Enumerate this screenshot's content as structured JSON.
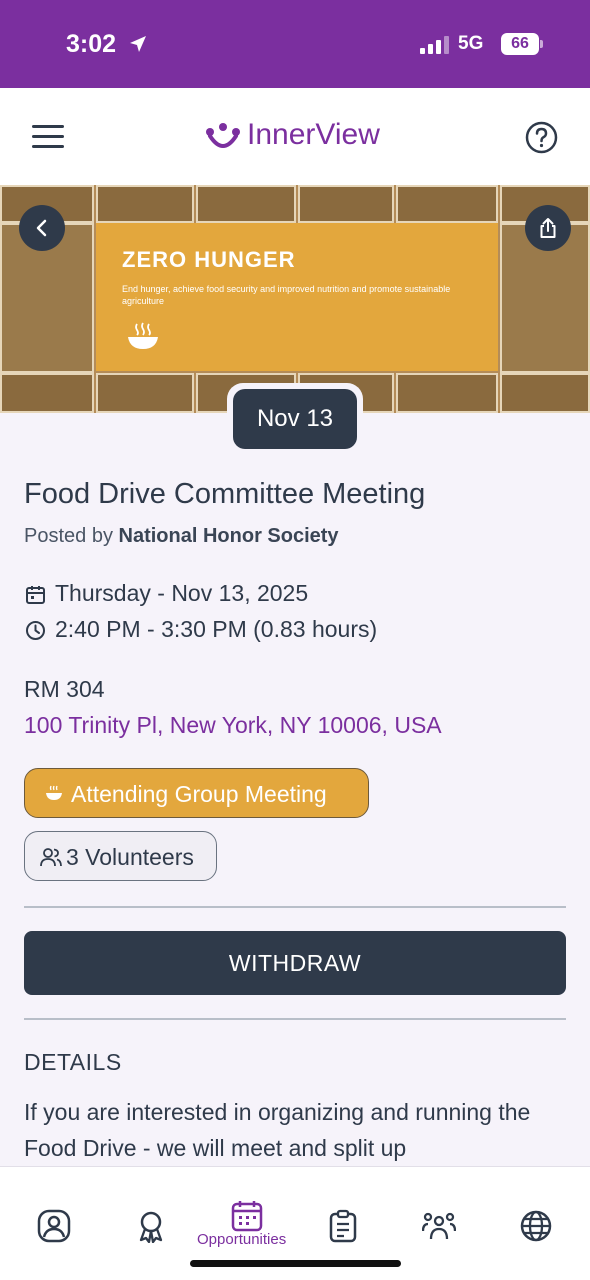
{
  "status_bar": {
    "time": "3:02",
    "network": "5G",
    "battery": "66"
  },
  "header": {
    "app_title": "InnerView"
  },
  "hero": {
    "title": "ZERO HUNGER",
    "subtitle": "End hunger, achieve food security and improved nutrition and promote sustainable agriculture"
  },
  "event": {
    "date_badge": "Nov 13",
    "title": "Food Drive Committee Meeting",
    "posted_by_prefix": "Posted by ",
    "posted_by": "National Honor Society",
    "date": "Thursday - Nov 13, 2025",
    "time": "2:40 PM - 3:30 PM (0.83 hours)",
    "room": "RM 304",
    "address": "100 Trinity Pl, New York, NY 10006, USA",
    "attending_label": "Attending Group Meeting",
    "volunteers_label": "3 Volunteers",
    "withdraw_label": "WITHDRAW",
    "details_heading": "DETAILS",
    "details_text": "If you are interested in organizing and running the Food Drive - we will meet and split up"
  },
  "tab_bar": {
    "active_label": "Opportunities",
    "tabs": [
      "profile-icon",
      "badge-icon",
      "calendar-icon",
      "clipboard-icon",
      "groups-icon",
      "globe-icon"
    ]
  },
  "colors": {
    "brand_purple": "#7b2f9f",
    "navy": "#2f3a4a",
    "gold": "#e3a73d"
  }
}
